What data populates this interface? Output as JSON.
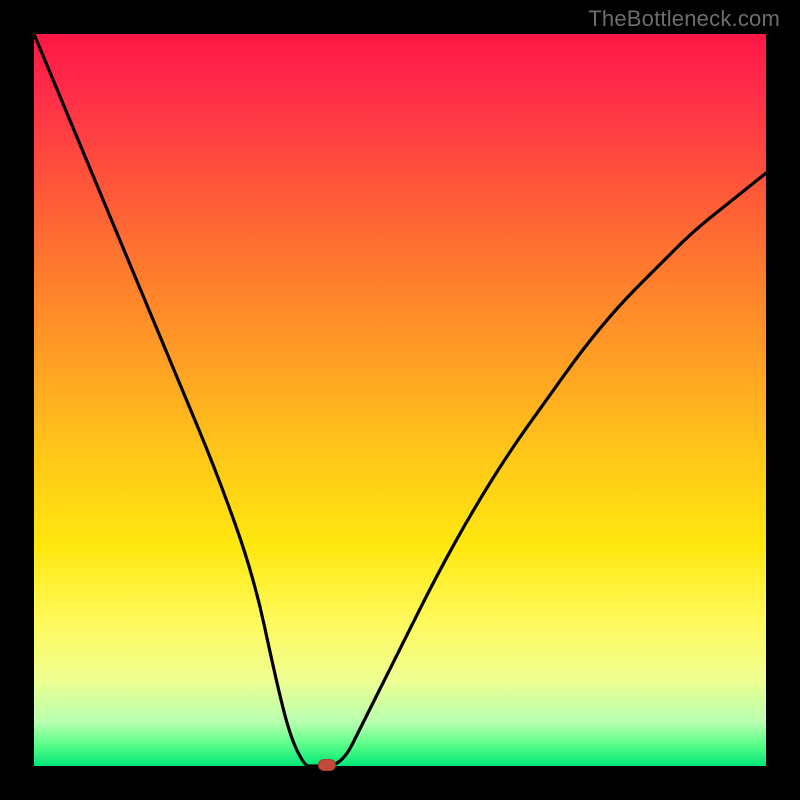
{
  "watermark": "TheBottleneck.com",
  "chart_data": {
    "type": "line",
    "title": "",
    "xlabel": "",
    "ylabel": "",
    "xlim": [
      0,
      100
    ],
    "ylim": [
      0,
      100
    ],
    "grid": false,
    "legend": false,
    "series": [
      {
        "name": "curve",
        "x": [
          0,
          5,
          10,
          15,
          20,
          25,
          30,
          33,
          35,
          37,
          38,
          42,
          45,
          50,
          55,
          60,
          65,
          70,
          75,
          80,
          85,
          90,
          95,
          100
        ],
        "y": [
          100,
          88,
          76,
          64,
          52,
          40,
          26,
          12,
          4,
          0,
          0,
          0,
          6,
          16,
          26,
          35,
          43,
          50,
          57,
          63,
          68,
          73,
          77,
          81
        ]
      }
    ],
    "flat_segment": {
      "x_start": 35,
      "x_end": 42,
      "y": 0
    },
    "marker": {
      "x": 40,
      "y": 0,
      "color": "#c24a3a"
    },
    "background_gradient": {
      "direction": "vertical",
      "stops": [
        {
          "pos": 0.0,
          "color": "#ff1744"
        },
        {
          "pos": 0.32,
          "color": "#ff7a2e"
        },
        {
          "pos": 0.7,
          "color": "#ffe80f"
        },
        {
          "pos": 0.94,
          "color": "#b8ffb0"
        },
        {
          "pos": 1.0,
          "color": "#00e676"
        }
      ]
    }
  },
  "layout": {
    "image_size": 800,
    "border": 34,
    "plot_size": 732
  }
}
